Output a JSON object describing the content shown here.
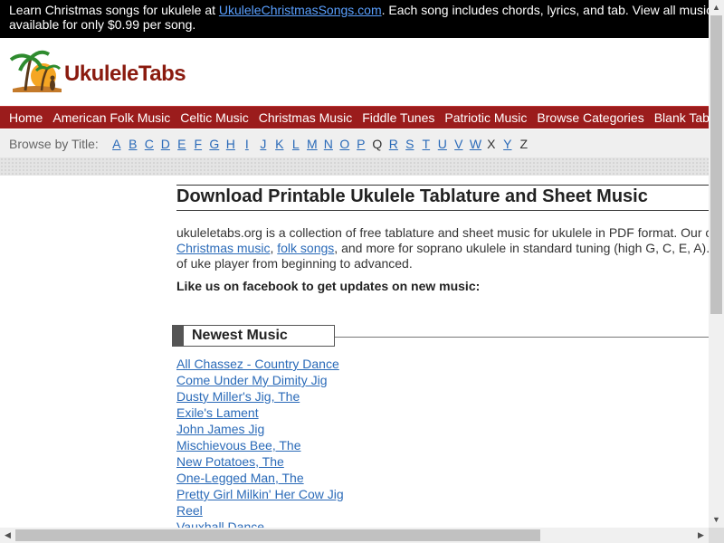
{
  "banner": {
    "text_before": "Learn Christmas songs for ukulele at ",
    "link": "UkuleleChristmasSongs.com",
    "text_after": ". Each song includes chords, lyrics, and tab. View all music for free o",
    "line2": "available for only $0.99 per song."
  },
  "logo": {
    "word1": "Ukulele",
    "word2": "Tabs"
  },
  "nav": {
    "items": [
      "Home",
      "American Folk Music",
      "Celtic Music",
      "Christmas Music",
      "Fiddle Tunes",
      "Patriotic Music",
      "Browse Categories",
      "Blank Tablature"
    ]
  },
  "browse": {
    "label": "Browse by Title:",
    "letters": [
      "A",
      "B",
      "C",
      "D",
      "E",
      "F",
      "G",
      "H",
      "I",
      "J",
      "K",
      "L",
      "M",
      "N",
      "O",
      "P",
      "Q",
      "R",
      "S",
      "T",
      "U",
      "V",
      "W",
      "X",
      "Y",
      "Z"
    ],
    "unlinked": [
      "Q",
      "X",
      "Z"
    ]
  },
  "main": {
    "title": "Download Printable Ukulele Tablature and Sheet Music",
    "intro_line1": "ukuleletabs.org is a collection of free tablature and sheet music for ukulele in PDF format. Our collectio",
    "intro_link1": "Christmas music",
    "intro_sep": ", ",
    "intro_link2": "folk songs",
    "intro_line2_rest": ", and more for soprano ukulele in standard tuning (high G, C, E, A). There",
    "intro_line3": "of uke player from beginning to advanced.",
    "facebook": "Like us on facebook to get updates on new music:"
  },
  "newest": {
    "title": "Newest Music",
    "songs": [
      "All Chassez - Country Dance",
      "Come Under My Dimity Jig",
      "Dusty Miller's Jig, The",
      "Exile's Lament",
      "John James Jig",
      "Mischievous Bee, The",
      "New Potatoes, The",
      "One-Legged Man, The",
      "Pretty Girl Milkin' Her Cow Jig",
      "Reel",
      "Vauxhall Dance"
    ]
  },
  "colors": {
    "nav_bg": "#9b1c1c",
    "link": "#2a6ab8",
    "banner_bg": "#000000",
    "banner_link": "#5aa0ff"
  }
}
